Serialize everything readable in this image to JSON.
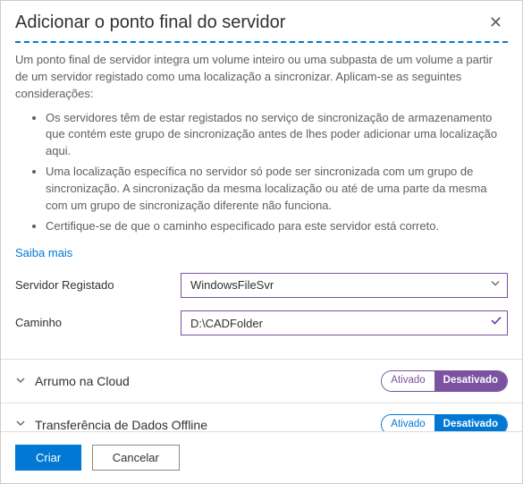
{
  "header": {
    "title": "Adicionar o ponto final do servidor"
  },
  "intro": "Um ponto final de servidor integra um volume inteiro ou uma subpasta de um volume a partir de um servidor registado como uma localização a sincronizar. Aplicam-se as seguintes considerações:",
  "bullets": [
    "Os servidores têm de estar registados no serviço de sincronização de armazenamento que contém este grupo de sincronização antes de lhes poder adicionar uma localização aqui.",
    "Uma localização específica no servidor só pode ser sincronizada com um grupo de sincronização. A sincronização da mesma localização ou até de uma parte da mesma com um grupo de sincronização diferente não funciona.",
    "Certifique-se de que o caminho especificado para este servidor está correto."
  ],
  "learnMore": "Saiba mais",
  "form": {
    "serverLabel": "Servidor Registado",
    "serverValue": "WindowsFileSvr",
    "pathLabel": "Caminho",
    "pathValue": "D:\\CADFolder"
  },
  "sections": {
    "cloudTiering": {
      "title": "Arrumo na Cloud",
      "onLabel": "Ativado",
      "offLabel": "Desativado"
    },
    "offlineData": {
      "title": "Transferência de Dados Offline",
      "onLabel": "Ativado",
      "offLabel": "Desativado"
    }
  },
  "footer": {
    "create": "Criar",
    "cancel": "Cancelar"
  }
}
